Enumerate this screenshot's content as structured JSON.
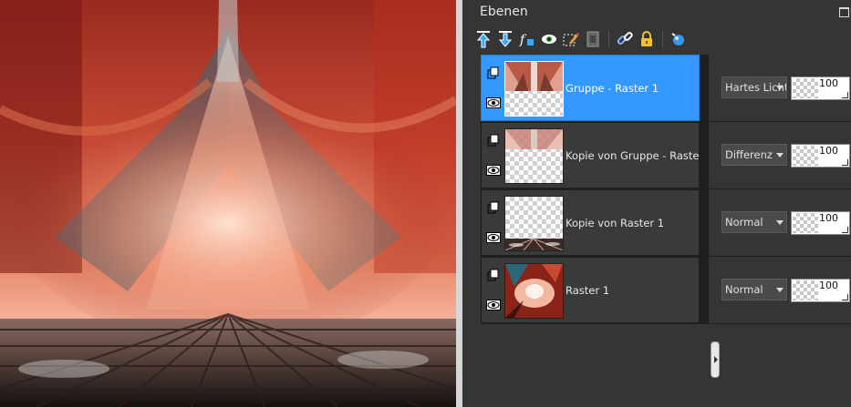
{
  "panel": {
    "title": "Ebenen"
  },
  "toolbar": {
    "icons": [
      "move-layer-up-icon",
      "move-layer-down-icon",
      "layer-effects-icon",
      "visibility-toggle-icon",
      "edit-selection-icon",
      "mask-icon",
      "link-layers-icon",
      "lock-layer-icon",
      "layer-style-icon"
    ]
  },
  "layers": [
    {
      "name": "Gruppe - Raster 1",
      "blend": "Hartes Licht",
      "opacity": "100",
      "selected": true
    },
    {
      "name": "Kopie von Gruppe - Raster",
      "blend": "Differenz",
      "opacity": "100",
      "selected": false
    },
    {
      "name": "Kopie von Raster 1",
      "blend": "Normal",
      "opacity": "100",
      "selected": false
    },
    {
      "name": "Raster 1",
      "blend": "Normal",
      "opacity": "100",
      "selected": false
    }
  ],
  "colors": {
    "selection": "#3398ff",
    "panel_bg": "#353535"
  }
}
